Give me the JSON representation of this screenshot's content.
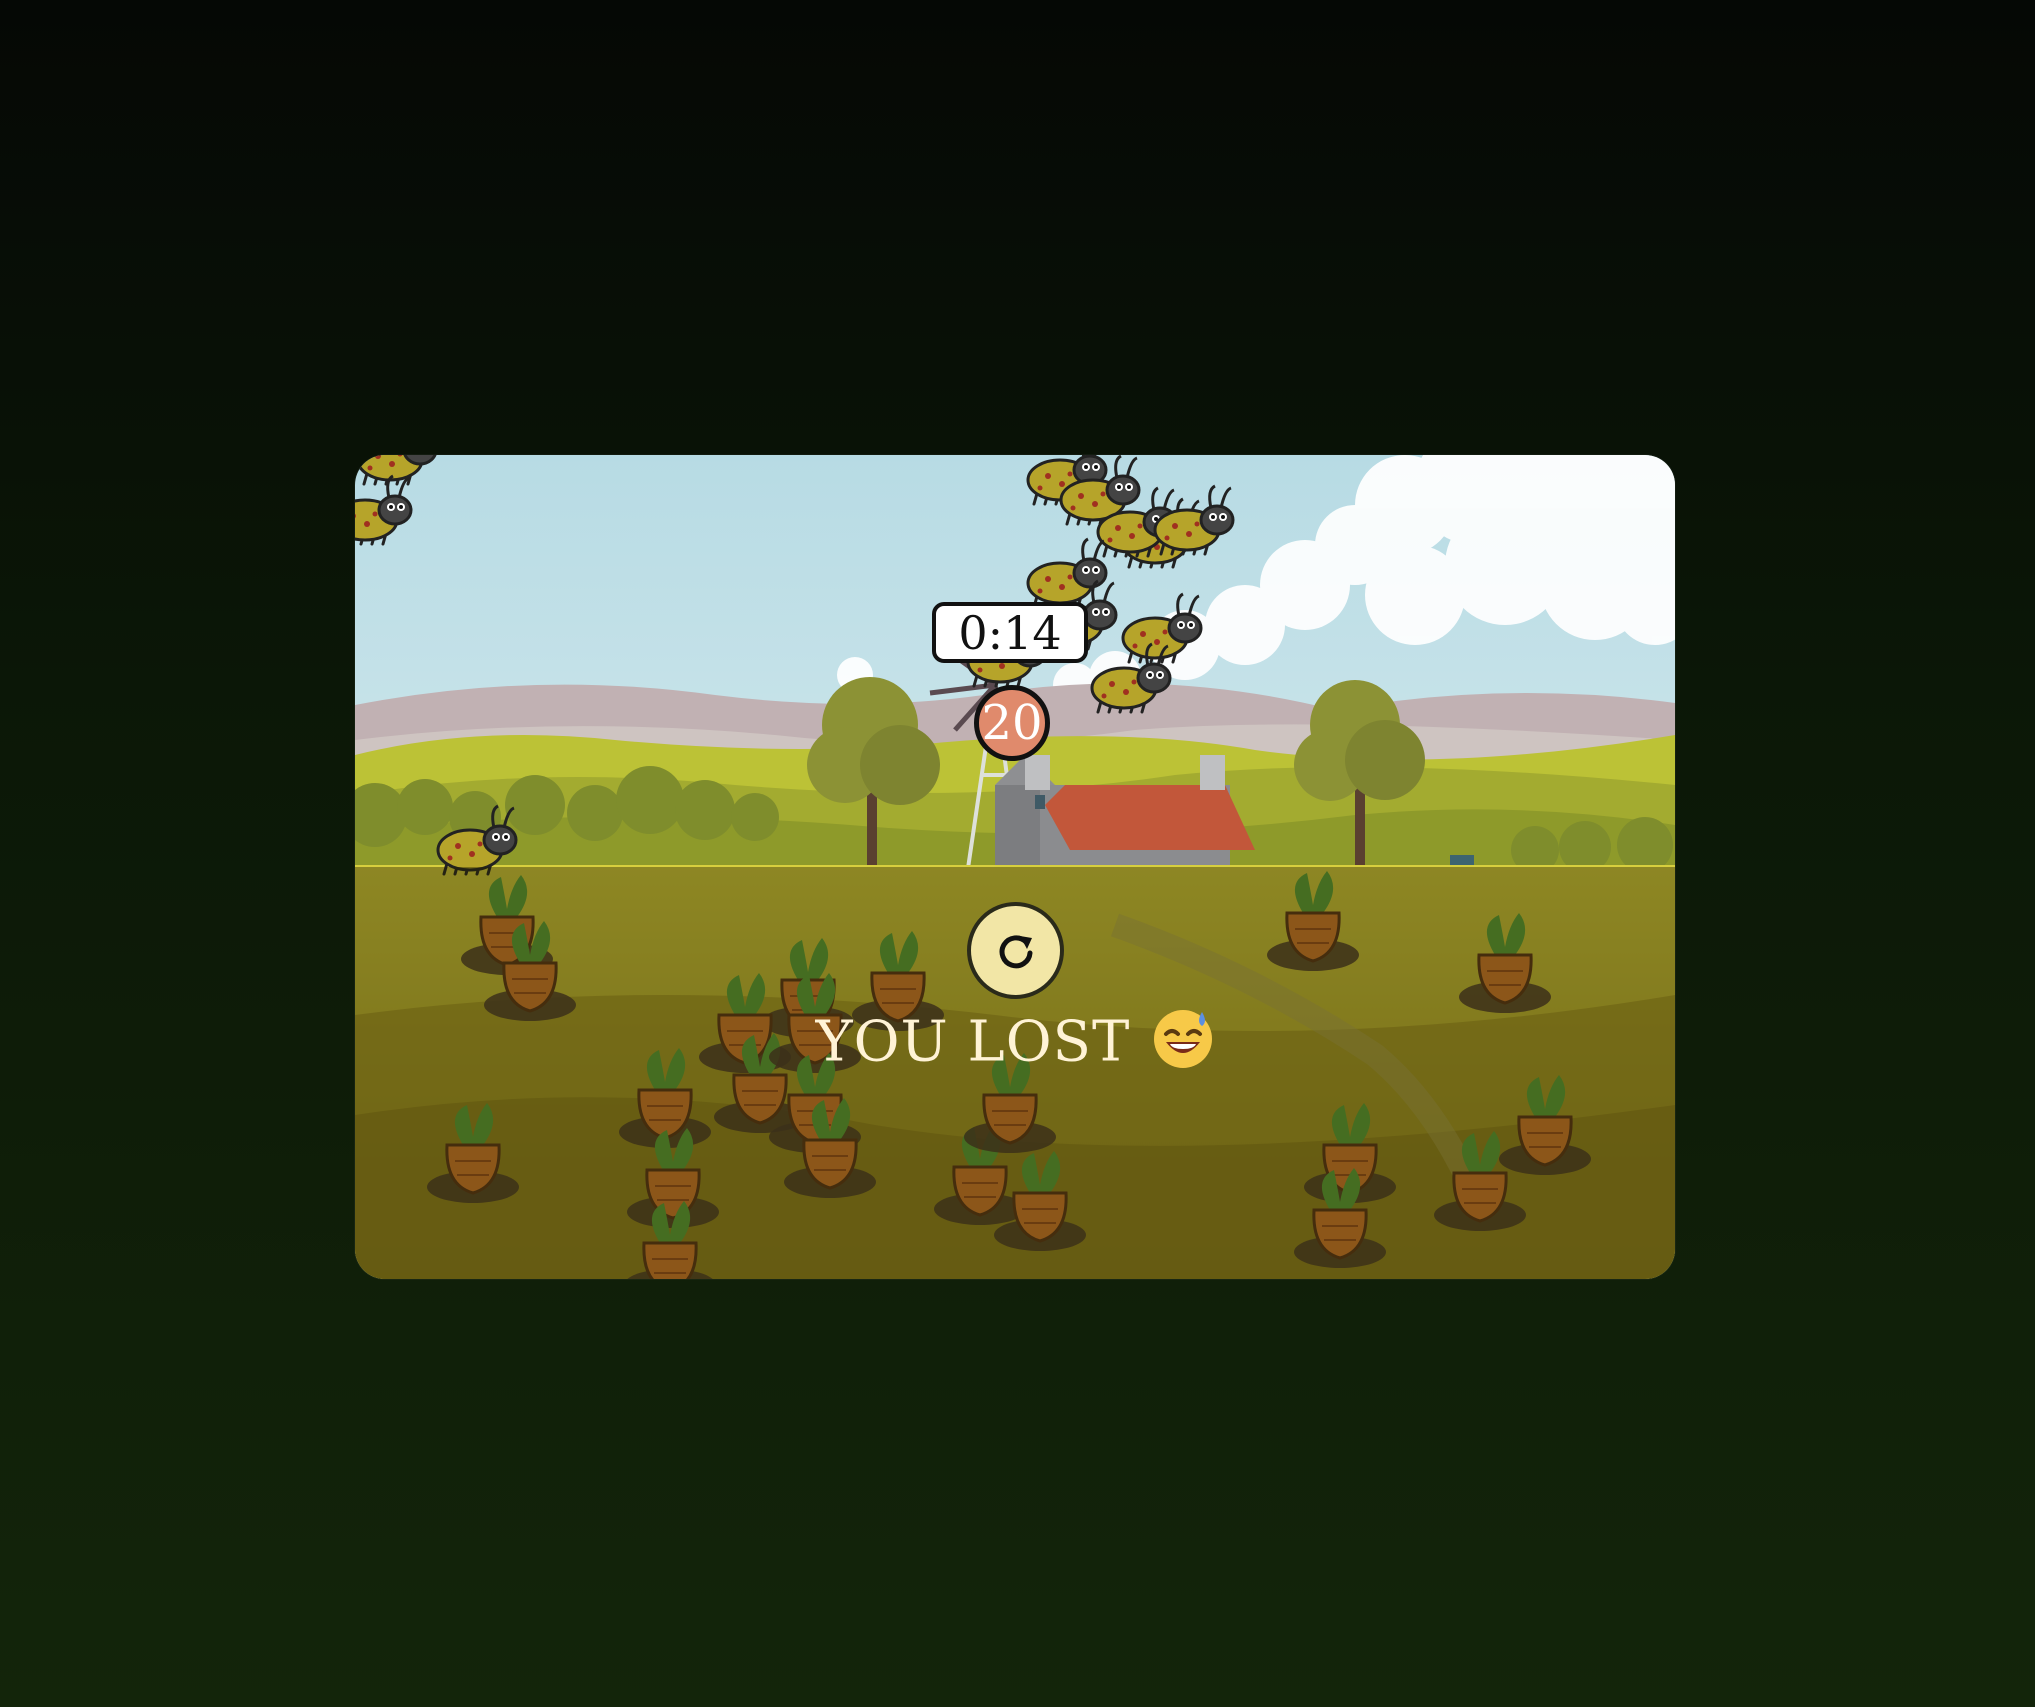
{
  "game": {
    "timer": "0:14",
    "score": "20",
    "message": "YOU LOST",
    "restart_icon": "restart-icon",
    "emoji_icon": "sweat-smile-emoji-icon"
  },
  "scene": {
    "background": "farm-landscape",
    "colors": {
      "sky": "#c3e0e7",
      "hills": "#c9b8b6",
      "field": "#c7bd3a",
      "soil": "#8c7a1a",
      "roof": "#c2573a",
      "carrot": "#d57a2c",
      "leaf": "#5aa33a"
    }
  }
}
